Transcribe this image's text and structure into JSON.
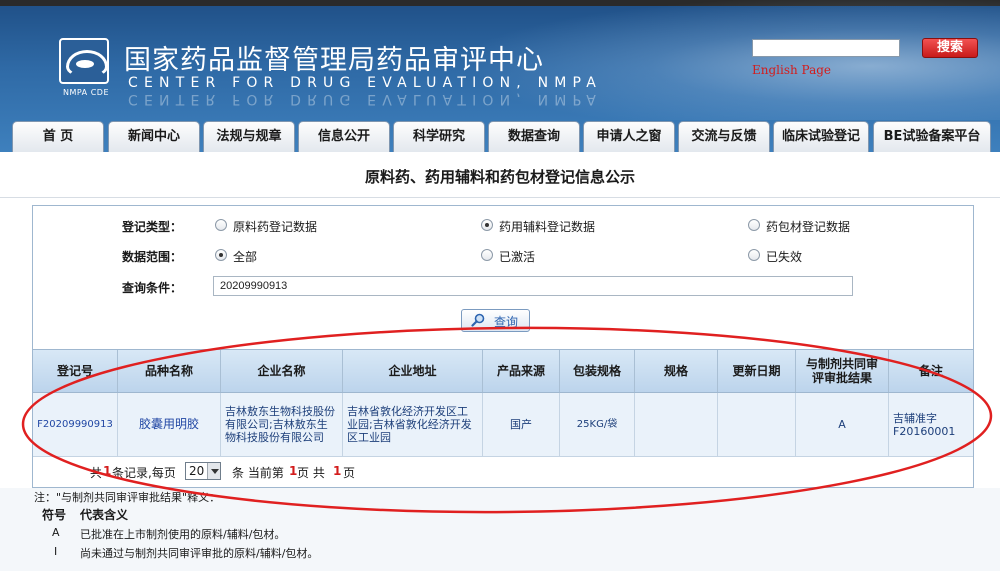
{
  "header": {
    "title_cn": "国家药品监督管理局药品审评中心",
    "title_en": "CENTER FOR DRUG EVALUATION, NMPA",
    "logo_text": "NMPA CDE",
    "search_value": "",
    "search_button": "搜索",
    "english_link": "English Page"
  },
  "nav": {
    "tabs": [
      {
        "label": "首 页"
      },
      {
        "label": "新闻中心"
      },
      {
        "label": "法规与规章"
      },
      {
        "label": "信息公开"
      },
      {
        "label": "科学研究"
      },
      {
        "label": "数据查询"
      },
      {
        "label": "申请人之窗"
      },
      {
        "label": "交流与反馈"
      },
      {
        "label": "临床试验登记"
      },
      {
        "label": "BE试验备案平台"
      }
    ]
  },
  "page_title": "原料药、药用辅料和药包材登记信息公示",
  "form": {
    "reg_type_label": "登记类型：",
    "reg_type_options": [
      {
        "label": "原料药登记数据",
        "selected": false
      },
      {
        "label": "药用辅料登记数据",
        "selected": true
      },
      {
        "label": "药包材登记数据",
        "selected": false
      }
    ],
    "scope_label": "数据范围：",
    "scope_options": [
      {
        "label": "全部",
        "selected": true
      },
      {
        "label": "已激活",
        "selected": false
      },
      {
        "label": "已失效",
        "selected": false
      }
    ],
    "query_label": "查询条件：",
    "query_value": "20209990913",
    "query_button": "查询"
  },
  "table": {
    "headers": [
      "登记号",
      "品种名称",
      "企业名称",
      "企业地址",
      "产品来源",
      "包装规格",
      "规格",
      "更新日期",
      "与制剂共同审评审批结果",
      "备注"
    ],
    "rows": [
      {
        "reg_no": "F20209990913",
        "variety": "胶囊用明胶",
        "company": "吉林敖东生物科技股份有限公司;吉林敖东生物科技股份有限公司",
        "address": "吉林省敦化经济开发区工业园;吉林省敦化经济开发区工业园",
        "source": "国产",
        "package": "25KG/袋",
        "spec": "",
        "update_date": "",
        "review_result": "A",
        "remark": "吉辅准字F20160001"
      }
    ]
  },
  "pager": {
    "prefix": "共",
    "total": "1",
    "mid": "条记录,每页",
    "page_size": "20",
    "after_select": "条 当前第",
    "current": "1",
    "of_pages": "页 共",
    "pages": "1",
    "suffix": "页"
  },
  "notes": {
    "title": "注：\"与制剂共同审评审批结果\"释义：",
    "col_symbol": "符号",
    "col_meaning": "代表含义",
    "items": [
      {
        "symbol": "A",
        "meaning": "已批准在上市制剂使用的原料/辅料/包材。"
      },
      {
        "symbol": "I",
        "meaning": "尚未通过与制剂共同审评审批的原料/辅料/包材。"
      }
    ]
  },
  "colors": {
    "header_blue": "#2f6aa6",
    "search_red": "#d31c1c",
    "annotation_red": "#e02020",
    "table_head": "#c9ddf0",
    "row_bg": "#eaf2fa"
  }
}
